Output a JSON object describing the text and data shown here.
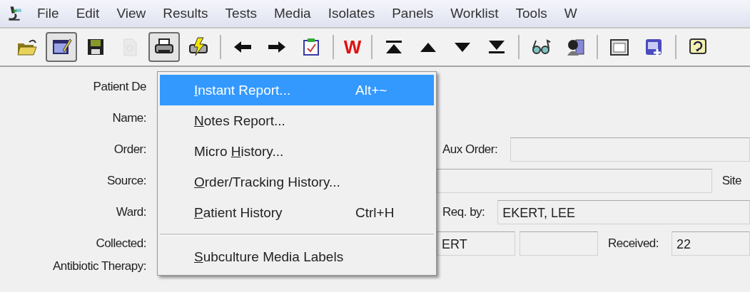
{
  "menubar": {
    "items": [
      "File",
      "Edit",
      "View",
      "Results",
      "Tests",
      "Media",
      "Isolates",
      "Panels",
      "Worklist",
      "Tools",
      "W"
    ]
  },
  "toolbar": [
    {
      "kind": "folder",
      "pressed": false,
      "disabled": false
    },
    {
      "kind": "edit",
      "pressed": true,
      "disabled": false
    },
    {
      "kind": "save",
      "pressed": false,
      "disabled": false
    },
    {
      "kind": "document",
      "pressed": false,
      "disabled": true
    },
    {
      "kind": "printer",
      "pressed": true,
      "disabled": false
    },
    {
      "kind": "flash-printer",
      "pressed": false,
      "disabled": false
    },
    {
      "kind": "separator"
    },
    {
      "kind": "left",
      "pressed": false,
      "disabled": false
    },
    {
      "kind": "right",
      "pressed": false,
      "disabled": false
    },
    {
      "kind": "calendar",
      "pressed": false,
      "disabled": false
    },
    {
      "kind": "separator"
    },
    {
      "kind": "text",
      "text": "W",
      "pressed": false,
      "disabled": false
    },
    {
      "kind": "separator"
    },
    {
      "kind": "first",
      "pressed": false,
      "disabled": false
    },
    {
      "kind": "up",
      "pressed": false,
      "disabled": false
    },
    {
      "kind": "down",
      "pressed": false,
      "disabled": false
    },
    {
      "kind": "last",
      "pressed": false,
      "disabled": false
    },
    {
      "kind": "separator"
    },
    {
      "kind": "glasses",
      "pressed": false,
      "disabled": false
    },
    {
      "kind": "person",
      "pressed": false,
      "disabled": false
    },
    {
      "kind": "separator"
    },
    {
      "kind": "form",
      "pressed": false,
      "disabled": false
    },
    {
      "kind": "form-add",
      "pressed": false,
      "disabled": false
    },
    {
      "kind": "separator"
    },
    {
      "kind": "help",
      "pressed": false,
      "disabled": false
    }
  ],
  "form": {
    "rows": [
      {
        "label": "Patient De"
      },
      {
        "label": "Name:"
      },
      {
        "label": "Order:",
        "right": [
          {
            "kind": "label",
            "text": "Aux Order:"
          },
          {
            "kind": "field"
          }
        ]
      },
      {
        "label": "Source:",
        "right": [
          {
            "kind": "field"
          },
          {
            "kind": "label",
            "text": "Site"
          }
        ]
      },
      {
        "label": "Ward:",
        "right": [
          {
            "kind": "label",
            "text": "Req. by:"
          },
          {
            "kind": "field",
            "value": "EKERT, LEE"
          }
        ]
      },
      {
        "label": "Collected:",
        "right": [
          {
            "kind": "field",
            "value": "ERT"
          },
          {
            "kind": "field"
          },
          {
            "kind": "label",
            "text": "Received:"
          },
          {
            "kind": "field",
            "value": "22"
          }
        ]
      },
      {
        "label": "Antibiotic Therapy:"
      }
    ]
  },
  "context_menu": {
    "groups": [
      [
        {
          "key": "I",
          "after": "nstant Report...",
          "shortcut": "Alt+~",
          "selected": true
        },
        {
          "key": "N",
          "after": "otes Report...",
          "selected": false
        },
        {
          "before": "Micro ",
          "key": "H",
          "after": "istory...",
          "selected": false
        },
        {
          "key": "O",
          "after": "rder/Tracking History...",
          "selected": false
        },
        {
          "key": "P",
          "after": "atient History",
          "shortcut": "Ctrl+H",
          "selected": false
        }
      ],
      [
        {
          "key": "S",
          "after": "ubculture Media Labels",
          "selected": false
        }
      ]
    ]
  }
}
